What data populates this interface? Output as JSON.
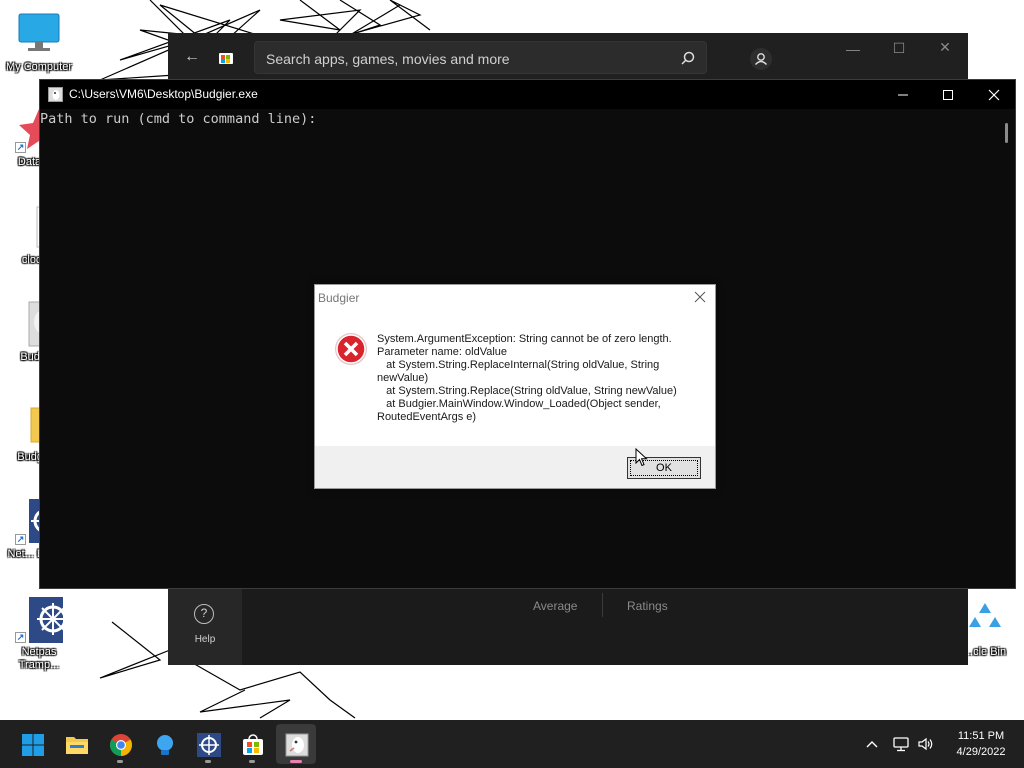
{
  "desktop": {
    "icons": [
      {
        "label": "My Computer"
      },
      {
        "label": "DataW..."
      },
      {
        "label": "clock..."
      },
      {
        "label": "Budgi..."
      },
      {
        "label": "Budgie..."
      },
      {
        "label": "Net... Estin..."
      },
      {
        "label": "Netpas Tramp..."
      },
      {
        "label": "...cle Bin"
      }
    ]
  },
  "store": {
    "search_placeholder": "Search apps, games, movies and more",
    "help_label": "Help",
    "average_label": "Average",
    "ratings_label": "Ratings"
  },
  "console": {
    "title": "C:\\Users\\VM6\\Desktop\\Budgier.exe",
    "text": "Path to run (cmd to command line):"
  },
  "dialog": {
    "title": "Budgier",
    "message": "System.ArgumentException: String cannot be of zero length.\nParameter name: oldValue\n   at System.String.ReplaceInternal(String oldValue, String newValue)\n   at System.String.Replace(String oldValue, String newValue)\n   at Budgier.MainWindow.Window_Loaded(Object sender, RoutedEventArgs e)",
    "ok_label": "OK"
  },
  "taskbar": {
    "apps": [
      "start",
      "file-explorer",
      "chrome",
      "tips",
      "netpas",
      "microsoft-store",
      "budgier"
    ],
    "active_app": "budgier",
    "time": "11:51 PM",
    "date": "4/29/2022"
  },
  "colors": {
    "console_bg": "#0c0c0c",
    "store_bg": "#202020",
    "taskbar_bg": "#202020",
    "error_red": "#d9232d",
    "win_blue": "#0078d4"
  }
}
